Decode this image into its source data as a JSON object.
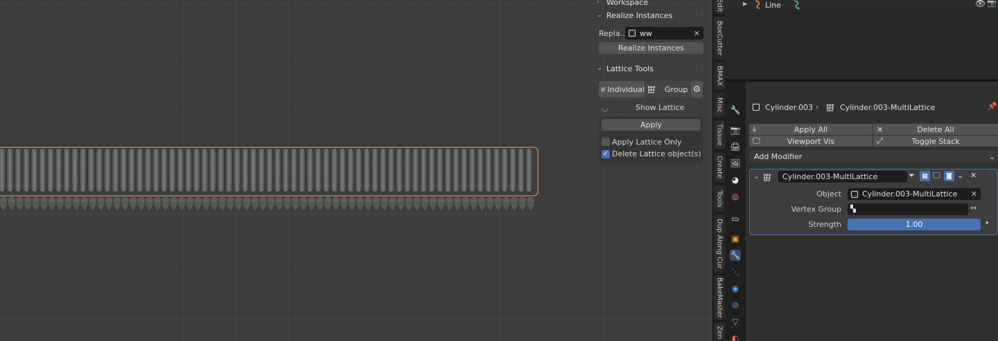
{
  "npanel": {
    "workspace_label": "Workspace",
    "realize": {
      "title": "Realize Instances",
      "replace_label": "Repla...",
      "replace_value": "ww",
      "button": "Realize Instances"
    },
    "lattice": {
      "title": "Lattice Tools",
      "individual": "Individual",
      "group": "Group",
      "show_lattice": "Show Lattice",
      "apply": "Apply",
      "apply_only": "Apply Lattice Only",
      "delete_objects": "Delete Lattice object(s)",
      "apply_only_checked": false,
      "delete_checked": true
    }
  },
  "sidebar_tabs": [
    "Edit",
    "BoxCutter",
    "BMAX",
    "Misc",
    "Tissue",
    "Create",
    "Tools",
    "Dup Along Cur",
    "BakeMaster",
    "Zen"
  ],
  "outliner": {
    "item": "Line"
  },
  "properties": {
    "object_name": "Cylinder.003",
    "modifier_name": "Cylinder.003-MultiLattice",
    "apply_all": "Apply All",
    "delete_all": "Delete All",
    "viewport_vis": "Viewport Vis",
    "toggle_stack": "Toggle Stack",
    "add_modifier": "Add Modifier",
    "modifier": {
      "name": "Cylinder.003-MultiLattice",
      "object_label": "Object",
      "object_value": "Cylinder.003-MultiLattice",
      "vertex_group_label": "Vertex Group",
      "vertex_group_value": "",
      "strength_label": "Strength",
      "strength_value": "1.00",
      "strength_fraction": 1.0
    }
  },
  "colors": {
    "accent": "#4772b3",
    "selection": "#e08a2c",
    "background": "#3d3d3d"
  }
}
